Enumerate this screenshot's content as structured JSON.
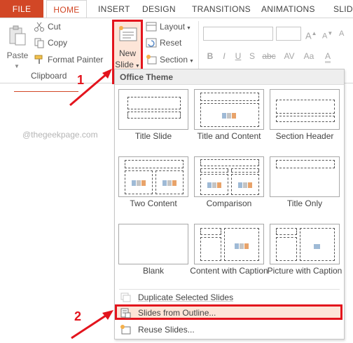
{
  "tabs": {
    "file": "FILE",
    "home": "HOME",
    "insert": "INSERT",
    "design": "DESIGN",
    "transitions": "TRANSITIONS",
    "animations": "ANIMATIONS",
    "slide_show": "SLIDE"
  },
  "clipboard": {
    "paste": "Paste",
    "cut": "Cut",
    "copy": "Copy",
    "format_painter": "Format Painter",
    "group_label": "Clipboard"
  },
  "slides": {
    "new_slide_line1": "New",
    "new_slide_line2": "Slide",
    "layout": "Layout",
    "reset": "Reset",
    "section": "Section"
  },
  "font": {
    "bold": "B",
    "italic": "I",
    "underline": "U",
    "strike": "S",
    "shadow": "abc",
    "spacing": "AV",
    "case": "Aa"
  },
  "watermark": "@thegeekpage.com",
  "dropdown": {
    "header": "Office Theme",
    "layouts": [
      {
        "label": "Title Slide"
      },
      {
        "label": "Title and Content"
      },
      {
        "label": "Section Header"
      },
      {
        "label": "Two Content"
      },
      {
        "label": "Comparison"
      },
      {
        "label": "Title Only"
      },
      {
        "label": "Blank"
      },
      {
        "label": "Content with Caption"
      },
      {
        "label": "Picture with Caption"
      }
    ],
    "duplicate": "Duplicate Selected Slides",
    "from_outline": "Slides from Outline...",
    "reuse": "Reuse Slides..."
  },
  "annotations": {
    "step1": "1",
    "step2": "2"
  },
  "colors": {
    "accent": "#d24726",
    "highlight_border": "#e3141d",
    "highlight_fill": "#fde5d8"
  }
}
